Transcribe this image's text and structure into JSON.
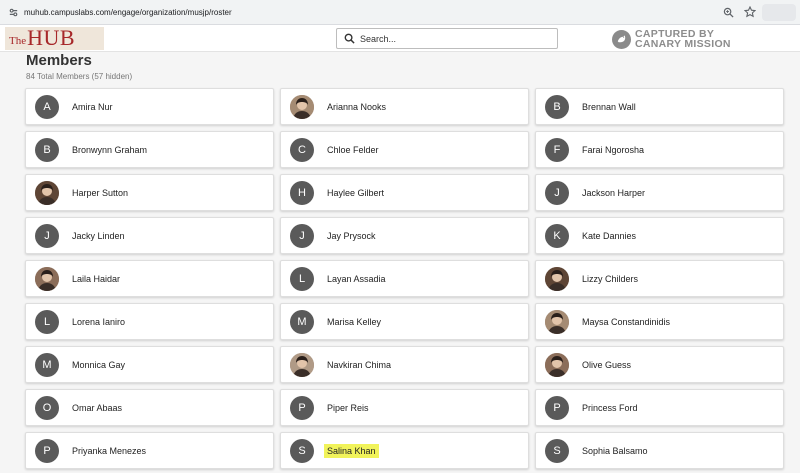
{
  "browser": {
    "url": "muhub.campuslabs.com/engage/organization/musjp/roster"
  },
  "header": {
    "logo_the": "The",
    "logo_hub": "HUB",
    "search_placeholder": "Search...",
    "watermark_line1": "CAPTURED BY",
    "watermark_line2": "CANARY MISSION"
  },
  "page": {
    "title": "Members",
    "count": "84 Total Members (57 hidden)"
  },
  "members": [
    {
      "name": "Amira Nur",
      "initial": "A",
      "photo": false,
      "highlight": false
    },
    {
      "name": "Arianna Nooks",
      "initial": "",
      "photo": true,
      "highlight": false
    },
    {
      "name": "Brennan Wall",
      "initial": "B",
      "photo": false,
      "highlight": false
    },
    {
      "name": "Bronwynn Graham",
      "initial": "B",
      "photo": false,
      "highlight": false
    },
    {
      "name": "Chloe Felder",
      "initial": "C",
      "photo": false,
      "highlight": false
    },
    {
      "name": "Farai Ngorosha",
      "initial": "F",
      "photo": false,
      "highlight": false
    },
    {
      "name": "Harper Sutton",
      "initial": "",
      "photo": true,
      "highlight": false
    },
    {
      "name": "Haylee Gilbert",
      "initial": "H",
      "photo": false,
      "highlight": false
    },
    {
      "name": "Jackson Harper",
      "initial": "J",
      "photo": false,
      "highlight": false
    },
    {
      "name": "Jacky Linden",
      "initial": "J",
      "photo": false,
      "highlight": false
    },
    {
      "name": "Jay Prysock",
      "initial": "J",
      "photo": false,
      "highlight": false
    },
    {
      "name": "Kate Dannies",
      "initial": "K",
      "photo": false,
      "highlight": false
    },
    {
      "name": "Laila Haidar",
      "initial": "",
      "photo": true,
      "highlight": false
    },
    {
      "name": "Layan Assadia",
      "initial": "L",
      "photo": false,
      "highlight": false
    },
    {
      "name": "Lizzy Childers",
      "initial": "",
      "photo": true,
      "highlight": false
    },
    {
      "name": "Lorena Ianiro",
      "initial": "L",
      "photo": false,
      "highlight": false
    },
    {
      "name": "Marisa Kelley",
      "initial": "M",
      "photo": false,
      "highlight": false
    },
    {
      "name": "Maysa Constandinidis",
      "initial": "",
      "photo": true,
      "highlight": false
    },
    {
      "name": "Monnica Gay",
      "initial": "M",
      "photo": false,
      "highlight": false
    },
    {
      "name": "Navkiran Chima",
      "initial": "",
      "photo": true,
      "highlight": false
    },
    {
      "name": "Olive Guess",
      "initial": "",
      "photo": true,
      "highlight": false
    },
    {
      "name": "Omar Abaas",
      "initial": "O",
      "photo": false,
      "highlight": false
    },
    {
      "name": "Piper Reis",
      "initial": "P",
      "photo": false,
      "highlight": false
    },
    {
      "name": "Princess Ford",
      "initial": "P",
      "photo": false,
      "highlight": false
    },
    {
      "name": "Priyanka Menezes",
      "initial": "P",
      "photo": false,
      "highlight": false
    },
    {
      "name": "Salina Khan",
      "initial": "S",
      "photo": false,
      "highlight": true
    },
    {
      "name": "Sophia Balsamo",
      "initial": "S",
      "photo": false,
      "highlight": false
    }
  ],
  "colors": {
    "accent": "#a7282a",
    "avatar_bg": "#5a5a5a",
    "highlight": "#f1f35a"
  }
}
